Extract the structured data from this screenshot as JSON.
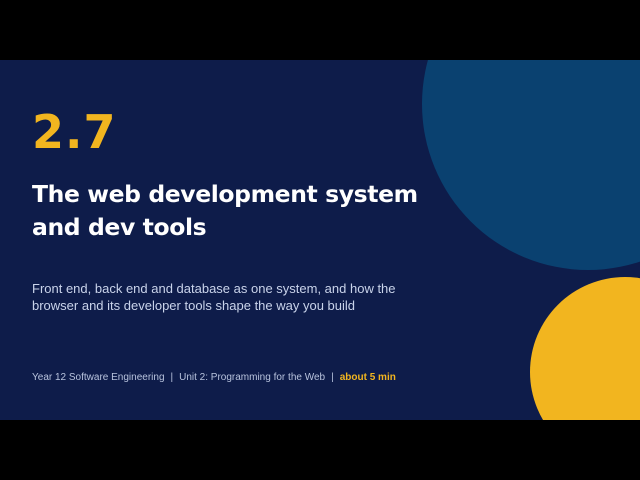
{
  "slide": {
    "number": "2.7",
    "title_line1": "The web development system",
    "title_line2": "and dev tools",
    "subtitle_line1": "Front end, back end and database as one system, and how the",
    "subtitle_line2": "browser and its developer tools shape the way you build",
    "footer": {
      "course": "Year 12 Software Engineering",
      "separator": "|",
      "unit": "Unit 2: Programming for the Web",
      "duration": "about 5 min"
    }
  },
  "colors": {
    "background": "#0e1c4a",
    "accent_yellow": "#f2b51f",
    "circle_blue": "#0a4170",
    "letterbox": "#000000"
  }
}
